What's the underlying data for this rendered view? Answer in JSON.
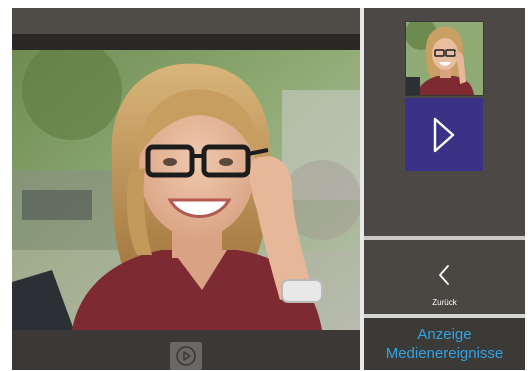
{
  "viewer": {
    "photo_alt": "Besucherfoto",
    "play_icon": "play-icon"
  },
  "side": {
    "thumbnail_icon": "visitor-thumbnail",
    "play_icon": "play-icon",
    "back": {
      "icon": "chevron-left-icon",
      "label": "Zurück"
    },
    "media_button": {
      "line1": "Anzeige",
      "line2": "Medienereignisse"
    }
  },
  "colors": {
    "accent_blue": "#31a3e3",
    "play_button": "#3b3287",
    "panel": "#4a4743"
  }
}
